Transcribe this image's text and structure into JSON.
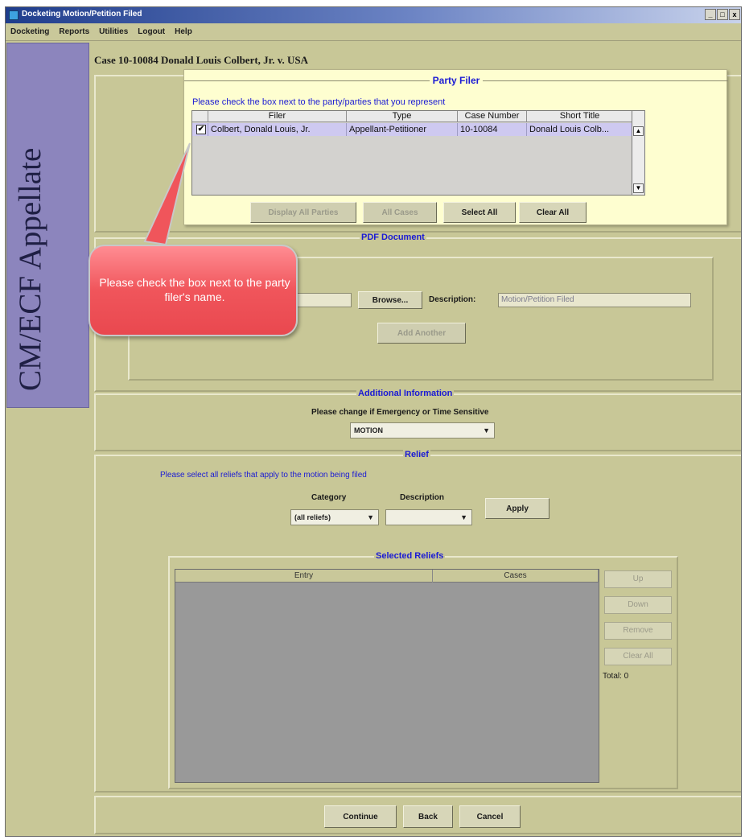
{
  "window": {
    "title": "Docketing Motion/Petition Filed",
    "minimize": "_",
    "maximize": "□",
    "close": "x"
  },
  "menu": [
    "Docketing",
    "Reports",
    "Utilities",
    "Logout",
    "Help"
  ],
  "sidebar": {
    "brand": "CM/ECF Appellate"
  },
  "case_title": "Case 10-10084 Donald Louis Colbert, Jr. v. USA",
  "party_filer": {
    "title": "Party Filer",
    "instruction": "Please check the box next to the party/parties that you represent",
    "columns": [
      "Filer",
      "Type",
      "Case Number",
      "Short Title"
    ],
    "rows": [
      {
        "checked": "✔",
        "filer": "Colbert, Donald Louis, Jr.",
        "type": "Appellant-Petitioner",
        "case_number": "10-10084",
        "short_title": "Donald Louis Colb..."
      }
    ],
    "buttons": {
      "display_all": "Display All Parties",
      "all_cases": "All Cases",
      "select_all": "Select All",
      "clear_all": "Clear All"
    }
  },
  "callout": {
    "text": "Please check the box next to the party filer's name."
  },
  "pdf": {
    "title": "PDF Document",
    "browse": "Browse...",
    "description_label": "Description:",
    "description_value": "Motion/Petition Filed",
    "add_another": "Add Another"
  },
  "additional": {
    "title": "Additional Information",
    "prompt": "Please change if Emergency or Time Sensitive",
    "selected": "MOTION"
  },
  "relief": {
    "title": "Relief",
    "instruction": "Please select all reliefs that apply to the motion being filed",
    "category_label": "Category",
    "category_value": "(all reliefs)",
    "description_label": "Description",
    "description_value": "",
    "apply": "Apply"
  },
  "selected_reliefs": {
    "title": "Selected Reliefs",
    "columns": [
      "Entry",
      "Cases"
    ],
    "buttons": {
      "up": "Up",
      "down": "Down",
      "remove": "Remove",
      "clear_all": "Clear All"
    },
    "total": "Total: 0"
  },
  "footer": {
    "continue": "Continue",
    "back": "Back",
    "cancel": "Cancel"
  }
}
